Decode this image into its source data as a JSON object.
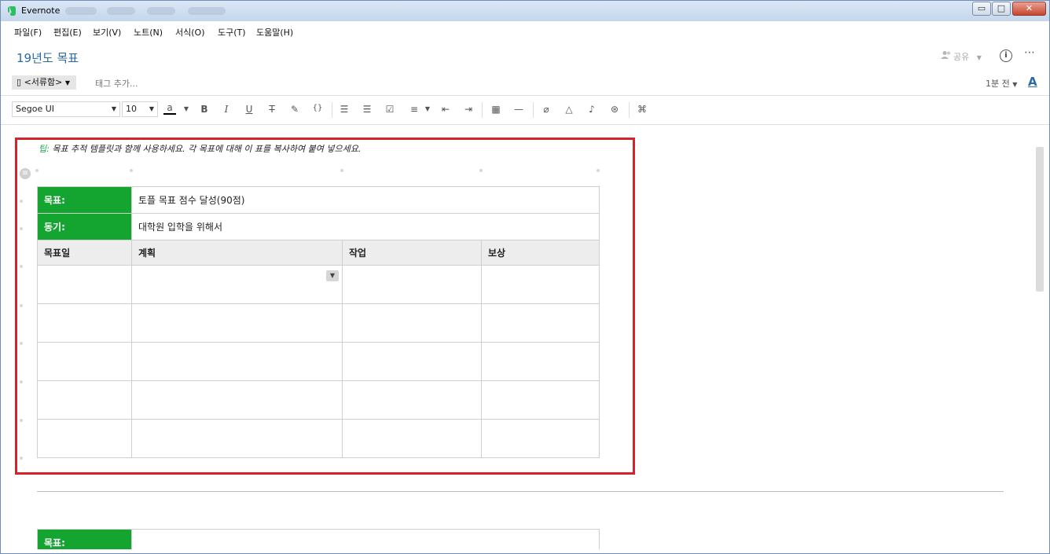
{
  "window": {
    "app_title": "Evernote",
    "controls": {
      "minimize": "▭",
      "maximize": "□",
      "close": "✕"
    }
  },
  "menu": [
    "파일(F)",
    "편집(E)",
    "보기(V)",
    "노트(N)",
    "서식(O)",
    "도구(T)",
    "도움말(H)"
  ],
  "note": {
    "title": "19년도 목표",
    "share_label": "공유",
    "notebook": "<서류함>",
    "tag_placeholder": "태그 추가...",
    "modified": "1분 전"
  },
  "toolbar": {
    "font": "Segoe UI",
    "size": "10",
    "text_color_label": "a",
    "accent_color": "#2a6aa8"
  },
  "content": {
    "tip_label": "팁:",
    "tip_text": " 목표 추적 템플릿과 함께 사용하세요. 각 목표에 대해 이 표를 복사하여 붙여 넣으세요.",
    "table1": {
      "goal_label": "목표:",
      "goal_value": "토플 목표 점수 달성(90점)",
      "motive_label": "동기:",
      "motive_value": "대학원 입학을 위해서",
      "headers": [
        "목표일",
        "계획",
        "작업",
        "보상"
      ],
      "rows": [
        [
          "",
          "",
          "",
          ""
        ],
        [
          "",
          "",
          "",
          ""
        ],
        [
          "",
          "",
          "",
          ""
        ],
        [
          "",
          "",
          "",
          ""
        ],
        [
          "",
          "",
          "",
          ""
        ]
      ]
    },
    "table2": {
      "goal_label": "목표:",
      "goal_value": ""
    },
    "green_color": "#14a531",
    "highlight_color": "#d5232b"
  }
}
